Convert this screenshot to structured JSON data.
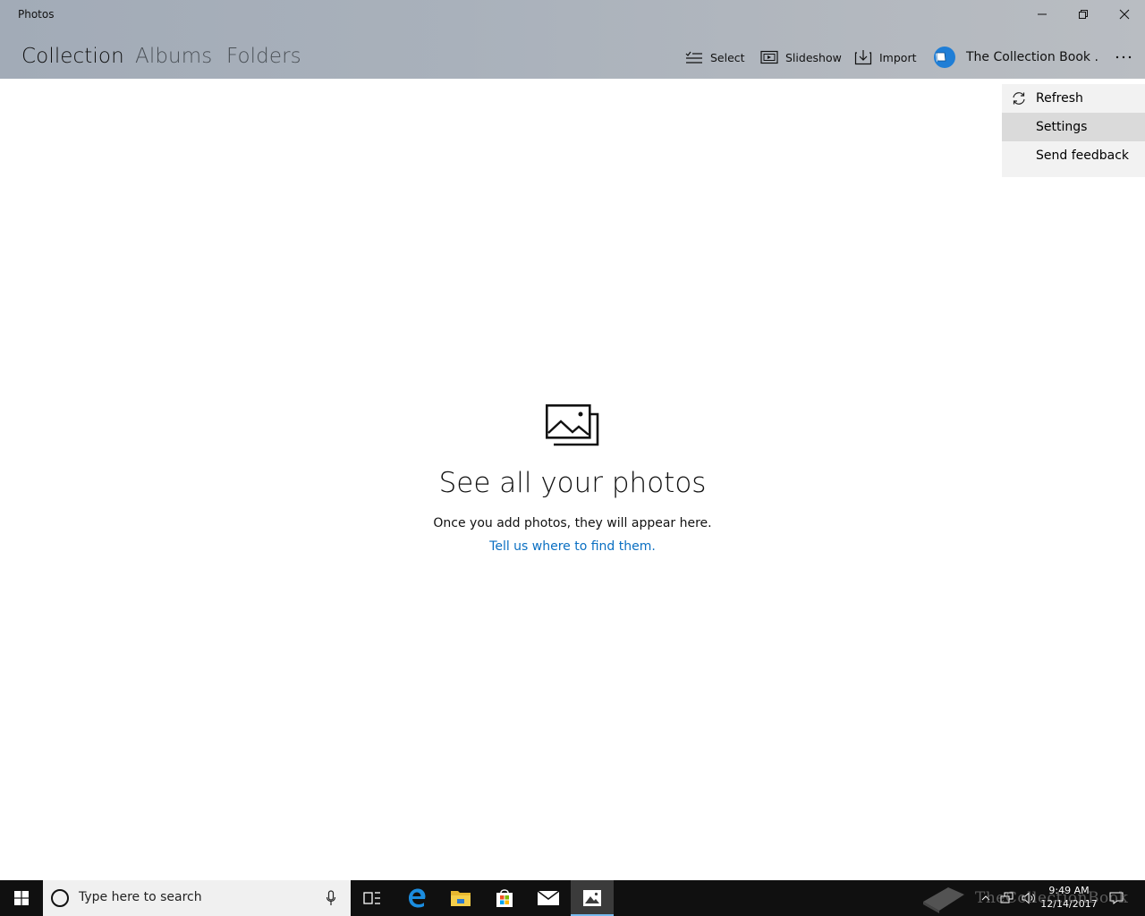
{
  "window": {
    "title": "Photos",
    "controls": {
      "minimize": "minimize-icon",
      "maximize": "restore-icon",
      "close": "close-icon"
    }
  },
  "nav": {
    "tabs": [
      {
        "label": "Collection",
        "active": true
      },
      {
        "label": "Albums",
        "active": false
      },
      {
        "label": "Folders",
        "active": false
      }
    ]
  },
  "toolbar": {
    "select_label": "Select",
    "slideshow_label": "Slideshow",
    "import_label": "Import",
    "account_label": "The Collection Book .",
    "more_icon": "more-icon"
  },
  "menu": {
    "items": [
      {
        "label": "Refresh",
        "icon": "refresh-icon"
      },
      {
        "label": "Settings",
        "highlighted": true
      },
      {
        "label": "Send feedback"
      }
    ]
  },
  "empty_state": {
    "title": "See all your photos",
    "subtitle": "Once you add photos, they will appear here.",
    "link": "Tell us where to find them."
  },
  "taskbar": {
    "search_placeholder": "Type here to search",
    "time": "9:49 AM",
    "date": "12/14/2017",
    "watermark": "TheCollectionBook",
    "apps": [
      "task-view-icon",
      "edge-icon",
      "file-explorer-icon",
      "store-icon",
      "mail-icon",
      "photos-icon"
    ]
  },
  "colors": {
    "header_bg": "#a9b1bb",
    "accent_link": "#0a6fc2",
    "taskbar_bg": "#101010",
    "menu_bg": "#f2f2f2",
    "menu_highlight": "#dadada"
  }
}
